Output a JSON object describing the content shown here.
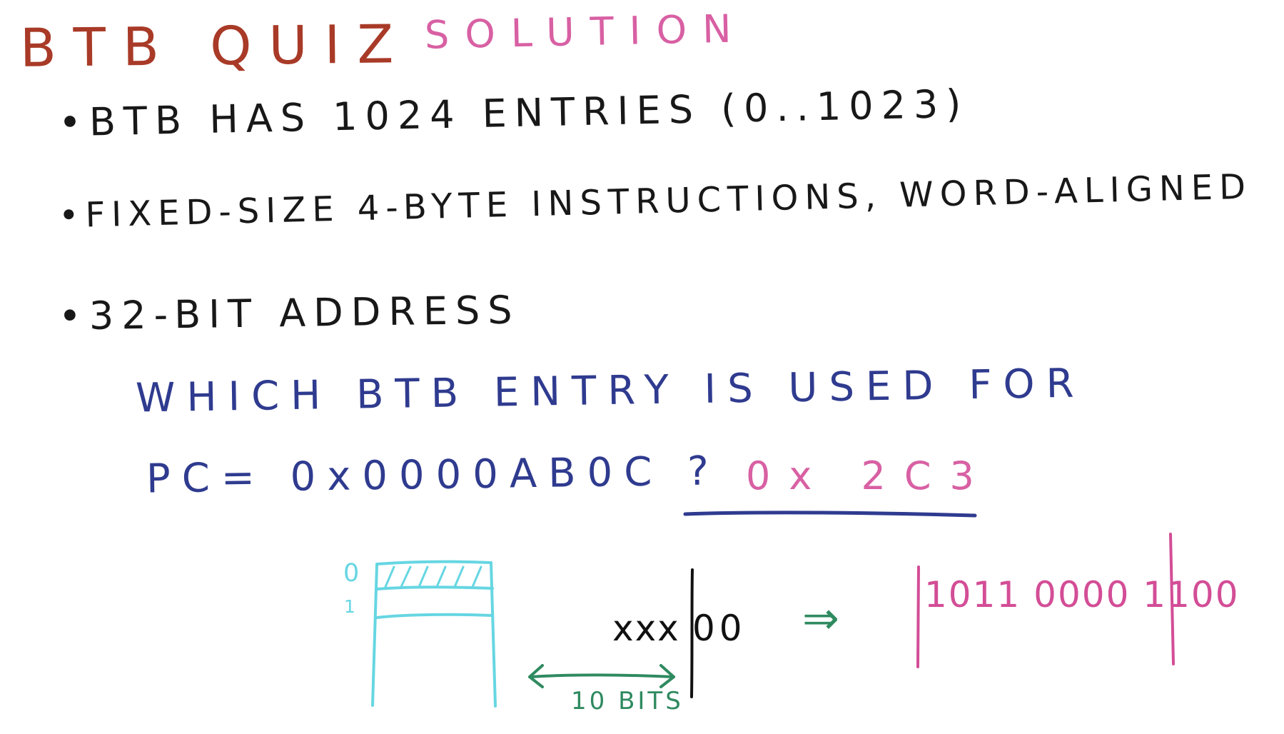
{
  "title": {
    "main": "BTB QUIZ",
    "sub": "SOLUTION"
  },
  "bullets": [
    "•BTB HAS 1024 ENTRIES (0..1023)",
    "•FIXED-SIZE 4-BYTE INSTRUCTIONS, WORD-ALIGNED",
    "•32-BIT ADDRESS"
  ],
  "question": {
    "line1": "WHICH BTB ENTRY IS USED FOR",
    "line2": "PC= 0x0000AB0C ?",
    "answer": "0x 2C3"
  },
  "diagram": {
    "entry_indices": [
      "0",
      "1"
    ],
    "address_bits": "xxx",
    "offset_bits": "00",
    "implies_symbol": "⇒",
    "binary_value": "1011 0000 1100",
    "width_label": "10 BITS"
  },
  "colors": {
    "title": "#a83a27",
    "solution": "#d860a3",
    "body": "#181818",
    "question": "#2f3b8f",
    "answer": "#d860a3",
    "diagram_cyan": "#66d6e2",
    "green": "#2f8a60",
    "binary": "#d34d96"
  }
}
